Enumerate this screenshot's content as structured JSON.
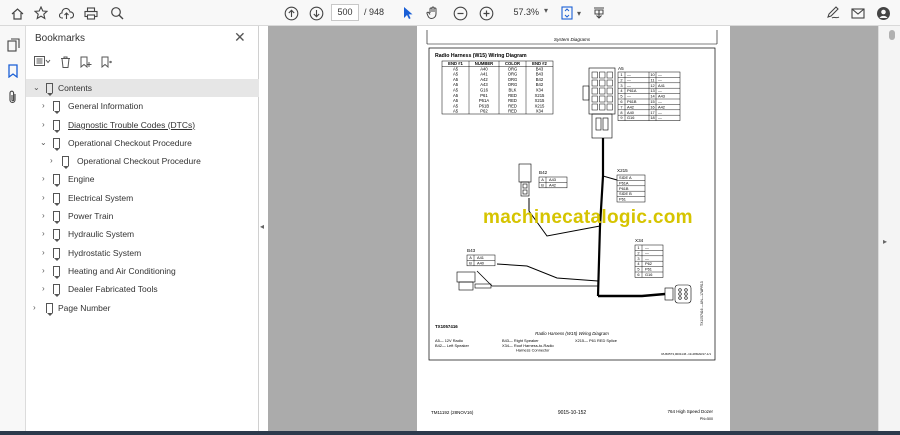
{
  "toolbar": {
    "page_current": "500",
    "page_total": "/ 948",
    "zoom": "57.3%"
  },
  "panel": {
    "title": "Bookmarks",
    "items": [
      {
        "label": "Contents"
      },
      {
        "label": "General Information"
      },
      {
        "label": "Diagnostic Trouble Codes (DTCs)"
      },
      {
        "label": "Operational Checkout Procedure"
      },
      {
        "label": "Operational Checkout Procedure"
      },
      {
        "label": "Engine"
      },
      {
        "label": "Electrical System"
      },
      {
        "label": "Power Train"
      },
      {
        "label": "Hydraulic System"
      },
      {
        "label": "Hydrostatic System"
      },
      {
        "label": "Heating and Air Conditioning"
      },
      {
        "label": "Dealer Fabricated Tools"
      },
      {
        "label": "Page Number"
      }
    ]
  },
  "document": {
    "header": "System Diagrams",
    "diagram_title": "Radio Harness (W15) Wiring Diagram",
    "table_headers": [
      "END #1",
      "NUMBER",
      "COLOR",
      "END #2"
    ],
    "table_rows": [
      [
        "A5",
        "A40",
        "ORG",
        "B43"
      ],
      [
        "A5",
        "A41",
        "ORG",
        "B43"
      ],
      [
        "A5",
        "A42",
        "ORG",
        "B42"
      ],
      [
        "A5",
        "A43",
        "ORG",
        "B42"
      ],
      [
        "A5",
        "G16",
        "BLK",
        "X34"
      ],
      [
        "A5",
        "P61",
        "RED",
        "X215"
      ],
      [
        "A5",
        "P61A",
        "RED",
        "X215"
      ],
      [
        "A5",
        "P61B",
        "RED",
        "X215"
      ],
      [
        "A5",
        "P62",
        "RED",
        "X34"
      ]
    ],
    "a5_label": "A5",
    "a5_pins_left": [
      "1",
      "2",
      "3",
      "4",
      "5",
      "6",
      "7",
      "8",
      "9"
    ],
    "a5_pins_mid": [
      "—",
      "—",
      "—",
      "P61A",
      "—",
      "P61B",
      "A42",
      "A40",
      "G16"
    ],
    "a5_pins_num2": [
      "10",
      "11",
      "12",
      "13",
      "14",
      "15",
      "16",
      "17",
      "18"
    ],
    "a5_pins_right": [
      "—",
      "—",
      "A41",
      "—",
      "A43",
      "—",
      "A42",
      "—",
      "—"
    ],
    "x215_label": "X215",
    "x215_rows": [
      "SIDE A",
      "P61A",
      "P61B",
      "SIDE B",
      "P61"
    ],
    "b42_label": "B42",
    "b42_rows": [
      [
        "A",
        "A43"
      ],
      [
        "B",
        "A42"
      ]
    ],
    "b43_label": "B43",
    "b43_rows": [
      [
        "A",
        "A41"
      ],
      [
        "B",
        "A40"
      ]
    ],
    "x34_label": "X34",
    "x34_rows": [
      [
        "1",
        "—"
      ],
      [
        "2",
        "—"
      ],
      [
        "3",
        "—"
      ],
      [
        "4",
        "P62"
      ],
      [
        "5",
        "P61"
      ],
      [
        "6",
        "G16"
      ]
    ],
    "side_text": "TX1057416 —UN—17APR13",
    "tx_code": "TX1057416",
    "caption": "Radio Harness (W15) Wiring Diagram",
    "legend_col1": [
      "A5— 12V Radio",
      "B42— Left Speaker"
    ],
    "legend_col2": [
      "B43— Right Speaker",
      "X34— Roof Harness-to-Radio",
      "Harness Connector"
    ],
    "legend_col3": [
      "X215— P61 RED Splice"
    ],
    "ref_code": "RU60573,0001146 -19-28MAR17-1/1",
    "footer_left": "TM11192 (28NOV16)",
    "footer_center": "9015-10-152",
    "footer_right": "764 High Speed Dozer",
    "footer_right2": "PN=500",
    "watermark": "machinecatalogic.com"
  }
}
